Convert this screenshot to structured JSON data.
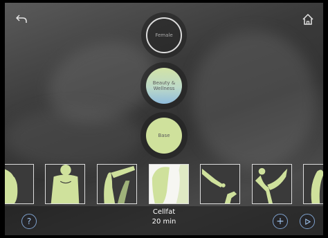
{
  "header": {
    "back_icon": "back-arrow-icon",
    "home_icon": "home-icon"
  },
  "menu": {
    "female_label": "Female",
    "beauty_label_line1": "Beauty &",
    "beauty_label_line2": "Wellness",
    "base_label": "Base"
  },
  "programs": [
    {
      "icon": "body-part-silhouette-icon",
      "selected": false
    },
    {
      "icon": "torso-silhouette-icon",
      "selected": false
    },
    {
      "icon": "arm-raised-silhouette-icon",
      "selected": false
    },
    {
      "icon": "buttocks-silhouette-icon",
      "selected": true
    },
    {
      "icon": "hands-silhouette-icon",
      "selected": false
    },
    {
      "icon": "dancer-pose-silhouette-icon",
      "selected": false
    },
    {
      "icon": "partial-silhouette-icon",
      "selected": false
    }
  ],
  "selection": {
    "program_name": "Cellfat",
    "duration": "20 min"
  },
  "footer": {
    "help_icon": "help-icon",
    "add_icon": "plus-icon",
    "play_icon": "play-icon"
  },
  "colors": {
    "accent_green": "#cfe19c",
    "accent_blue": "#8fbcdc",
    "button_ring": "#7fa2ce"
  }
}
